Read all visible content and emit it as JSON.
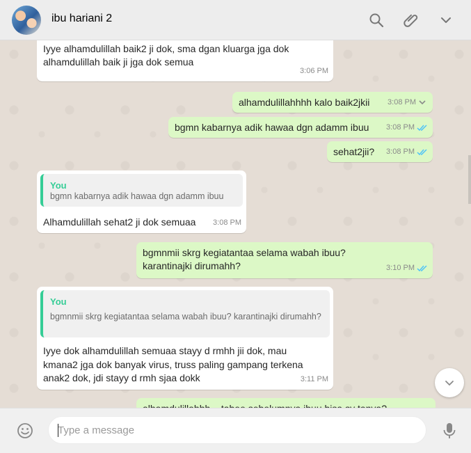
{
  "header": {
    "contact_name": "ibu hariani 2",
    "icons": [
      "avatar",
      "search-icon",
      "attach-icon",
      "chevron-down-icon"
    ]
  },
  "messages": [
    {
      "direction": "in",
      "quote_author": "",
      "text": "Iyye alhamdulillah baik2 ji dok, sma dgan kluarga jga dok alhamdulillah baik ji jga dok semua",
      "time": "3:06 PM"
    },
    {
      "direction": "out",
      "text": "alhamdulillahhhh kalo baik2jkii",
      "time": "3:08 PM",
      "menu_open": true
    },
    {
      "direction": "out",
      "text": "bgmn kabarnya adik hawaa dgn adamm ibuu",
      "time": "3:08 PM",
      "ticks": "read"
    },
    {
      "direction": "out",
      "text": "sehat2jii?",
      "time": "3:08 PM",
      "ticks": "read"
    },
    {
      "direction": "in",
      "quote_author": "You",
      "quote_text": "bgmn kabarnya adik hawaa dgn adamm ibuu",
      "text": "Alhamdulillah sehat2 ji dok semuaa",
      "time": "3:08 PM"
    },
    {
      "direction": "out",
      "text": "bgmnmii skrg kegiatantaa selama wabah ibuu? karantinajki dirumahh?",
      "time": "3:10 PM",
      "ticks": "read"
    },
    {
      "direction": "in",
      "quote_author": "You",
      "quote_text": "bgmnmii skrg kegiatantaa selama wabah ibuu? karantinajki dirumahh?",
      "text": "Iyye dok alhamdulillah semuaa stayy d rmhh jii dok, mau kmana2 jga dok banyak virus, truss paling gampang terkena anak2 dok, jdi stayy d rmh sjaa dokk",
      "time": "3:11 PM"
    },
    {
      "direction": "out",
      "text": "alhamdulillahhh... tabee sebelumnya ibuu bisa sy tanya?",
      "time": "",
      "partial": true
    }
  ],
  "composer": {
    "placeholder": "Type a message",
    "icons": [
      "emoji-icon",
      "microphone-icon"
    ]
  },
  "colors": {
    "header_bg": "#ededed",
    "chat_bg": "#e5ddd5",
    "outgoing_bubble": "#dcf8c6",
    "incoming_bubble": "#ffffff",
    "read_ticks": "#4fc3f7",
    "quote_accent": "#35cd96"
  }
}
